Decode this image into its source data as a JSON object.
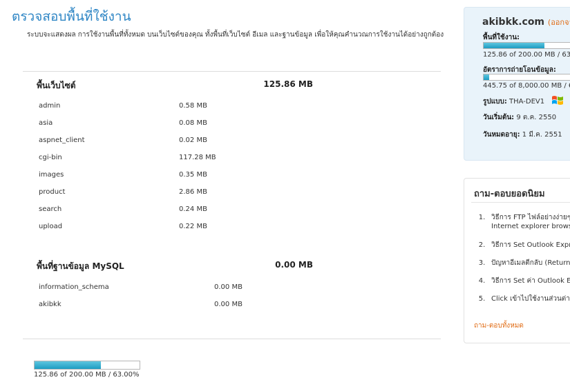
{
  "page": {
    "title": "ตรวจสอบพื้นที่ใช้งาน",
    "intro": "ระบบจะแสดงผล การใช้งานพื้นที่ทั้งหมด บนเว็บไซต์ของคุณ ทั้งพื้นที่เว็บไซต์ อีเมล และฐานข้อมูล เพื่อให้คุณคำนวณการใช้งานได้อย่างถูกต้อง"
  },
  "web_space": {
    "heading": "พื้นเว็บไซต์",
    "total": "125.86 MB",
    "rows": [
      {
        "name": "admin",
        "size": "0.58 MB"
      },
      {
        "name": "asia",
        "size": "0.08 MB"
      },
      {
        "name": "aspnet_client",
        "size": "0.02 MB"
      },
      {
        "name": "cgi-bin",
        "size": "117.28 MB"
      },
      {
        "name": "images",
        "size": "0.35 MB"
      },
      {
        "name": "product",
        "size": "2.86 MB"
      },
      {
        "name": "search",
        "size": "0.24 MB"
      },
      {
        "name": "upload",
        "size": "0.22 MB"
      }
    ]
  },
  "mysql_space": {
    "heading": "พื้นที่ฐานข้อมูล MySQL",
    "total": "0.00 MB",
    "rows": [
      {
        "name": "information_schema",
        "size": "0.00 MB"
      },
      {
        "name": "akibkk",
        "size": "0.00 MB"
      }
    ]
  },
  "usage_summary": {
    "caption": "125.86 of 200.00 MB / 63.00%",
    "percent": 63.0
  },
  "account": {
    "domain": "akibkk.com",
    "logout_label": "(ออกจาก",
    "space_label": "พื้นที่ใช้งาน:",
    "space_percent": 63.0,
    "space_text": "125.86 of 200.00 MB / 63.",
    "transfer_label": "อัตราการถ่ายโอนข้อมูล:",
    "transfer_percent": 5.6,
    "transfer_text": "445.75 of 8,000.00 MB / 6",
    "platform_label": "รูปแบบ:",
    "platform_value": "THA-DEV1",
    "platform_icon": "windows-logo-icon",
    "start_label": "วันเริ่มต้น:",
    "start_value": "9 ต.ค. 2550",
    "expire_label": "วันหมดอายุ:",
    "expire_value": "1 มี.ค. 2551"
  },
  "faq": {
    "title": "ถาม-ตอบยอดนิยม",
    "items": [
      {
        "num": "1.",
        "line1": "วิธีการ FTP ไฟล์อย่างง่ายๆ",
        "line2": "Internet explorer brows"
      },
      {
        "num": "2.",
        "line1": "วิธีการ Set Outlook Expre",
        "line2": ""
      },
      {
        "num": "3.",
        "line1": "ปัญหาอีเมลตีกลับ (Return",
        "line2": ""
      },
      {
        "num": "4.",
        "line1": "วิธีการ Set ค่า Outlook Ex",
        "line2": ""
      },
      {
        "num": "5.",
        "line1": "Click เข้าไปใช้งานส่วนต่าง",
        "line2": ""
      }
    ],
    "all_link": "ถาม-ตอบทั้งหมด"
  },
  "colors": {
    "title_blue": "#2f86c5",
    "bar_fill": "#1d9cc2",
    "link_orange": "#e06a12",
    "info_bg": "#e9f3fa"
  }
}
